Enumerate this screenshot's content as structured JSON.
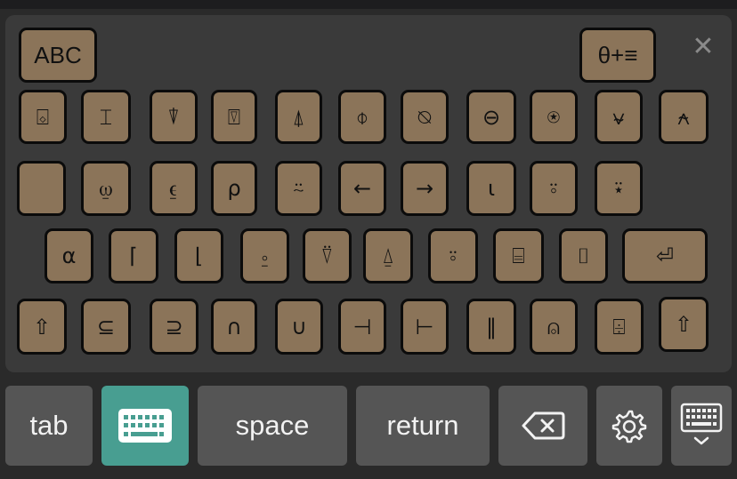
{
  "toolbar": {
    "abc_label": "ABC",
    "symbols_label": "θ+≡",
    "close_glyph": "✕"
  },
  "rows": [
    [
      "⌺",
      "⌶",
      "⍒",
      "⍔",
      "⍋",
      "⌽",
      "⍉",
      "⊖",
      "⍟",
      "⍱",
      "⍲"
    ],
    [
      "",
      "⍹",
      "⍷",
      "⍴",
      "⍨",
      "←",
      "→",
      "⍳",
      "⍤",
      "⍣"
    ],
    [
      "⍺",
      "⌈",
      "⌊",
      "⍛",
      "⍢",
      "⍙",
      "⍤",
      "⌸",
      "⌷",
      "⏎"
    ],
    [
      "⇧",
      "⊆",
      "⊇",
      "∩",
      "∪",
      "⊣",
      "⊢",
      "‖",
      "⍝",
      "⌹",
      "⇧"
    ]
  ],
  "bottom": {
    "tab_label": "tab",
    "space_label": "space",
    "return_label": "return"
  },
  "colors": {
    "key_fill": "#8b7459",
    "key_border": "#0b0b0b",
    "panel": "#3a3a3a",
    "bottom_button": "#555555",
    "active_button": "#489e91"
  },
  "icons": [
    "keyboard-icon",
    "backspace-icon",
    "gear-icon",
    "keyboard-dismiss-icon",
    "close-icon"
  ]
}
